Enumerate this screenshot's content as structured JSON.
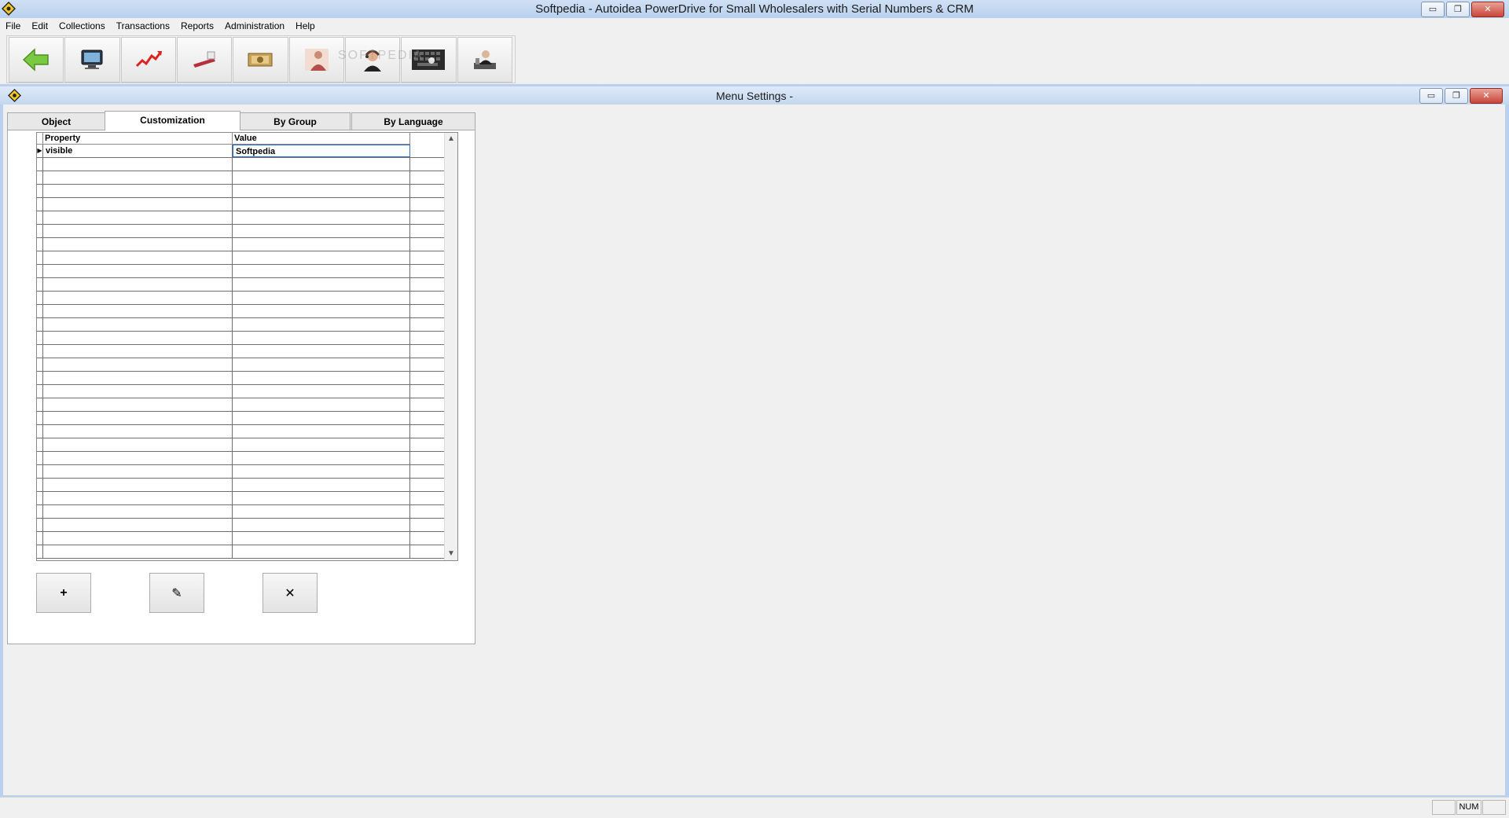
{
  "app": {
    "title": "Softpedia - Autoidea PowerDrive for Small Wholesalers with Serial Numbers & CRM",
    "minimize_glyph": "▭",
    "restore_glyph": "❐",
    "close_glyph": "✕"
  },
  "menu": {
    "items": [
      {
        "label": "File"
      },
      {
        "label": "Edit"
      },
      {
        "label": "Collections"
      },
      {
        "label": "Transactions"
      },
      {
        "label": "Reports"
      },
      {
        "label": "Administration"
      },
      {
        "label": "Help"
      }
    ]
  },
  "toolbar": {
    "buttons": [
      {
        "icon": "back-arrow-icon"
      },
      {
        "icon": "monitor-icon"
      },
      {
        "icon": "chart-trend-icon"
      },
      {
        "icon": "stapler-icon"
      },
      {
        "icon": "money-icon"
      },
      {
        "icon": "person-icon"
      },
      {
        "icon": "support-agent-icon"
      },
      {
        "icon": "keyboard-icon"
      },
      {
        "icon": "businessman-icon"
      }
    ],
    "watermark": "SOFTPEDIA"
  },
  "child_window": {
    "title": "Menu Settings -"
  },
  "tabs": [
    {
      "label": "Object",
      "active": false
    },
    {
      "label": "Customization",
      "active": true
    },
    {
      "label": "By Group",
      "active": false
    },
    {
      "label": "By Language",
      "active": false
    }
  ],
  "grid": {
    "columns": [
      "Property",
      "Value"
    ],
    "rows": [
      {
        "property": "visible",
        "value": "Softpedia",
        "current": true
      }
    ],
    "empty_rows": 30
  },
  "actions": {
    "add_glyph": "+",
    "edit_glyph": "✎",
    "delete_glyph": "✕"
  },
  "statusbar": {
    "num": "NUM"
  },
  "colors": {
    "titlebar": "#b9d1ee",
    "selection_border": "#2a6fd6",
    "back_arrow": "#7ac943"
  }
}
